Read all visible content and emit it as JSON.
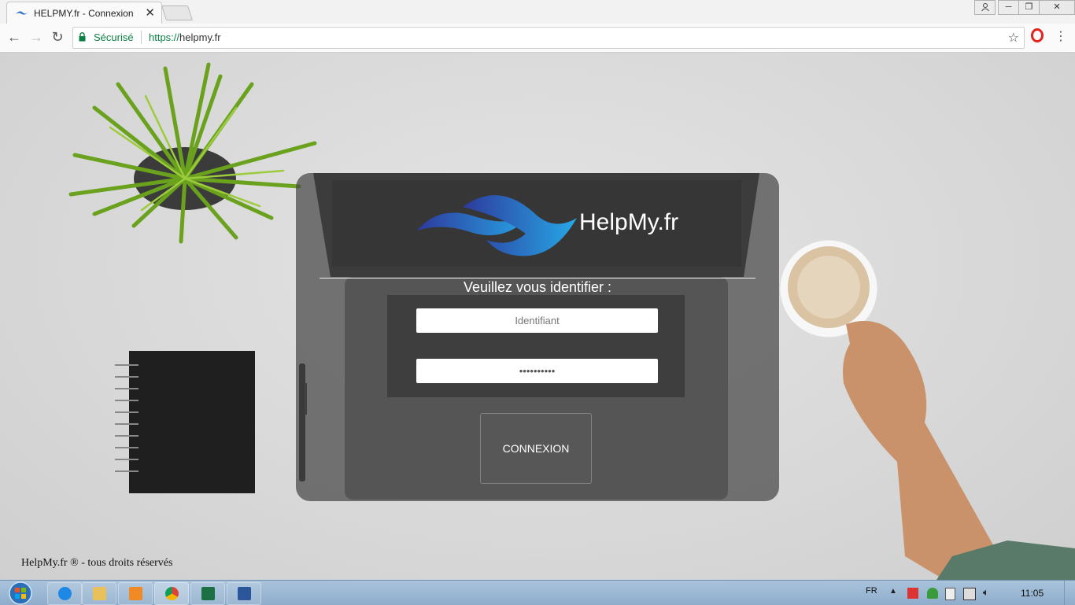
{
  "browser": {
    "tab_title": "HELPMY.fr - Connexion",
    "security_label": "Sécurisé",
    "url_protocol": "https://",
    "url_host": "helpmy.fr"
  },
  "login": {
    "brand": "HelpMy.fr",
    "prompt": "Veuillez vous identifier :",
    "username_placeholder": "Identifiant",
    "password_value": "••••••••••",
    "submit_label": "CONNEXION"
  },
  "footer": {
    "copyright": "HelpMy.fr ® - tous droits réservés"
  },
  "taskbar": {
    "language": "FR",
    "clock": "11:05",
    "pinned": [
      "internet-explorer-icon",
      "file-explorer-icon",
      "media-player-icon",
      "chrome-icon",
      "excel-icon",
      "word-icon"
    ]
  },
  "colors": {
    "logo_blue_dark": "#2d3a9e",
    "logo_blue_light": "#27a8e6",
    "secure_green": "#0b8043",
    "opera_red": "#e0231b"
  }
}
